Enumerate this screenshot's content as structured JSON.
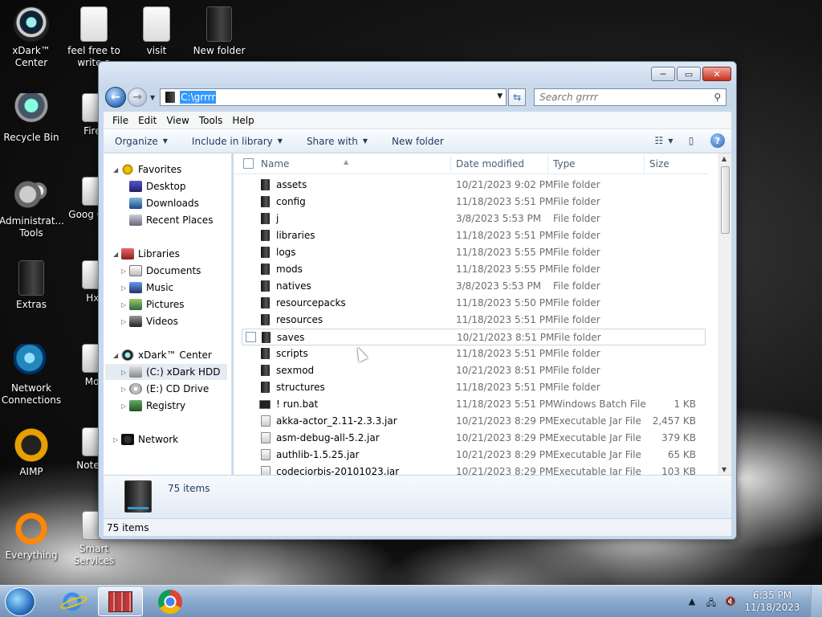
{
  "desktop": {
    "icons": [
      {
        "label": "xDark™ Center",
        "icon": "xdark-icon"
      },
      {
        "label": "feel free to write a",
        "icon": "document-icon"
      },
      {
        "label": "visit",
        "icon": "document-icon"
      },
      {
        "label": "New folder",
        "icon": "folder-icon"
      },
      {
        "label": "Recycle Bin",
        "icon": "recycle-bin-icon"
      },
      {
        "label": "Firef",
        "icon": "app-icon"
      },
      {
        "label": "Administrat... Tools",
        "icon": "gears-icon"
      },
      {
        "label": "Goog Chro",
        "icon": "app-icon"
      },
      {
        "label": "Extras",
        "icon": "folder-icon"
      },
      {
        "label": "Hxl",
        "icon": "app-icon"
      },
      {
        "label": "Network Connections",
        "icon": "globe-icon"
      },
      {
        "label": "Mot",
        "icon": "app-icon"
      },
      {
        "label": "AIMP",
        "icon": "aimp-icon"
      },
      {
        "label": "Notepa",
        "icon": "app-icon"
      },
      {
        "label": "Everything",
        "icon": "everything-icon"
      },
      {
        "label": "Smart Services",
        "icon": "app-icon"
      }
    ]
  },
  "window": {
    "controls": {
      "minimize": "─",
      "maximize": "▭",
      "close": "✕"
    },
    "address": "C:\\grrrr",
    "search_placeholder": "Search grrrr",
    "menu": [
      "File",
      "Edit",
      "View",
      "Tools",
      "Help"
    ],
    "toolbar": {
      "organize": "Organize",
      "include": "Include in library",
      "share": "Share with",
      "new_folder": "New folder"
    },
    "nav": {
      "favorites": "Favorites",
      "desktop": "Desktop",
      "downloads": "Downloads",
      "recent": "Recent Places",
      "libraries": "Libraries",
      "documents": "Documents",
      "music": "Music",
      "pictures": "Pictures",
      "videos": "Videos",
      "xdark": "xDark™ Center",
      "c_drive": "(C:) xDark HDD",
      "e_drive": "(E:) CD Drive",
      "registry": "Registry",
      "network": "Network"
    },
    "columns": {
      "name": "Name",
      "date": "Date modified",
      "type": "Type",
      "size": "Size"
    },
    "files": [
      {
        "name": "assets",
        "date": "10/21/2023 9:02 PM",
        "type": "File folder",
        "size": "",
        "kind": "folder"
      },
      {
        "name": "config",
        "date": "11/18/2023 5:51 PM",
        "type": "File folder",
        "size": "",
        "kind": "folder"
      },
      {
        "name": "j",
        "date": "3/8/2023 5:53 PM",
        "type": "File folder",
        "size": "",
        "kind": "folder"
      },
      {
        "name": "libraries",
        "date": "11/18/2023 5:51 PM",
        "type": "File folder",
        "size": "",
        "kind": "folder"
      },
      {
        "name": "logs",
        "date": "11/18/2023 5:55 PM",
        "type": "File folder",
        "size": "",
        "kind": "folder"
      },
      {
        "name": "mods",
        "date": "11/18/2023 5:55 PM",
        "type": "File folder",
        "size": "",
        "kind": "folder"
      },
      {
        "name": "natives",
        "date": "3/8/2023 5:53 PM",
        "type": "File folder",
        "size": "",
        "kind": "folder"
      },
      {
        "name": "resourcepacks",
        "date": "11/18/2023 5:50 PM",
        "type": "File folder",
        "size": "",
        "kind": "folder"
      },
      {
        "name": "resources",
        "date": "11/18/2023 5:51 PM",
        "type": "File folder",
        "size": "",
        "kind": "folder"
      },
      {
        "name": "saves",
        "date": "10/21/2023 8:51 PM",
        "type": "File folder",
        "size": "",
        "kind": "folder"
      },
      {
        "name": "scripts",
        "date": "11/18/2023 5:51 PM",
        "type": "File folder",
        "size": "",
        "kind": "folder"
      },
      {
        "name": "sexmod",
        "date": "10/21/2023 8:51 PM",
        "type": "File folder",
        "size": "",
        "kind": "folder"
      },
      {
        "name": "structures",
        "date": "11/18/2023 5:51 PM",
        "type": "File folder",
        "size": "",
        "kind": "folder"
      },
      {
        "name": "! run.bat",
        "date": "11/18/2023 5:51 PM",
        "type": "Windows Batch File",
        "size": "1 KB",
        "kind": "bat"
      },
      {
        "name": "akka-actor_2.11-2.3.3.jar",
        "date": "10/21/2023 8:29 PM",
        "type": "Executable Jar File",
        "size": "2,457 KB",
        "kind": "jar"
      },
      {
        "name": "asm-debug-all-5.2.jar",
        "date": "10/21/2023 8:29 PM",
        "type": "Executable Jar File",
        "size": "379 KB",
        "kind": "jar"
      },
      {
        "name": "authlib-1.5.25.jar",
        "date": "10/21/2023 8:29 PM",
        "type": "Executable Jar File",
        "size": "65 KB",
        "kind": "jar"
      },
      {
        "name": "codecjorbis-20101023.jar",
        "date": "10/21/2023 8:29 PM",
        "type": "Executable Jar File",
        "size": "103 KB",
        "kind": "jar"
      }
    ],
    "details_count": "75 items",
    "status_count": "75 items"
  },
  "taskbar": {
    "time": "6:35 PM",
    "date": "11/18/2023"
  }
}
